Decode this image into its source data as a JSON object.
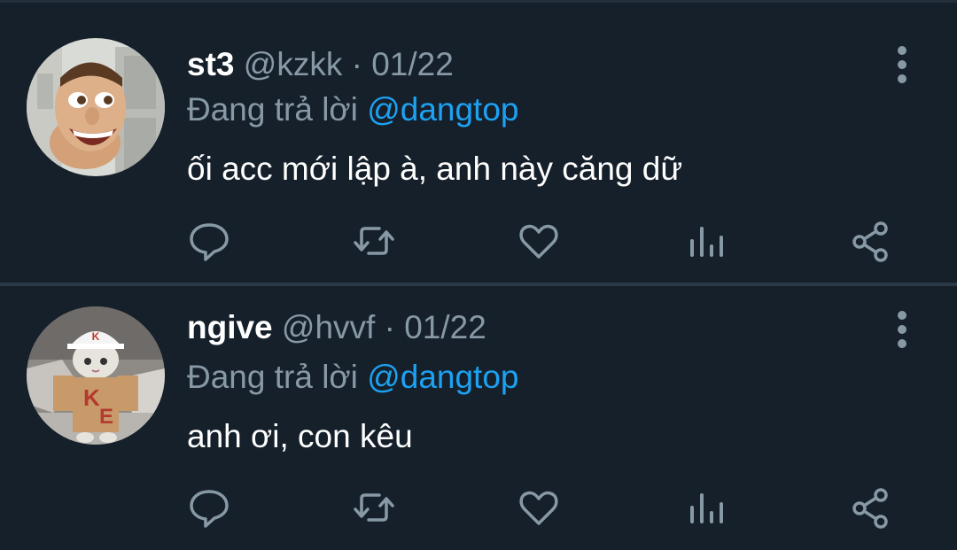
{
  "tweets": [
    {
      "name": "st3",
      "handle": "@kzkk",
      "separator": "·",
      "date": "01/22",
      "reply_prefix": "Đang trả lời",
      "reply_mention": "@dangtop",
      "text": "ối acc mới lập à, anh này căng dữ",
      "avatar": "woody-face-avatar"
    },
    {
      "name": "ngive",
      "handle": "@hvvf",
      "separator": "·",
      "date": "01/22",
      "reply_prefix": "Đang trả lời",
      "reply_mention": "@dangtop",
      "text": "anh ơi, con kêu",
      "avatar": "cat-in-costume-avatar"
    }
  ],
  "icons": {
    "reply": "comment-icon",
    "retweet": "retweet-icon",
    "like": "heart-icon",
    "analytics": "bar-chart-icon",
    "share": "share-icon",
    "more": "more-vertical-icon"
  },
  "colors": {
    "background": "#15202b",
    "name": "#ffffff",
    "secondary": "#8899a6",
    "mention": "#1da1f2",
    "divider": "#2b3947"
  }
}
